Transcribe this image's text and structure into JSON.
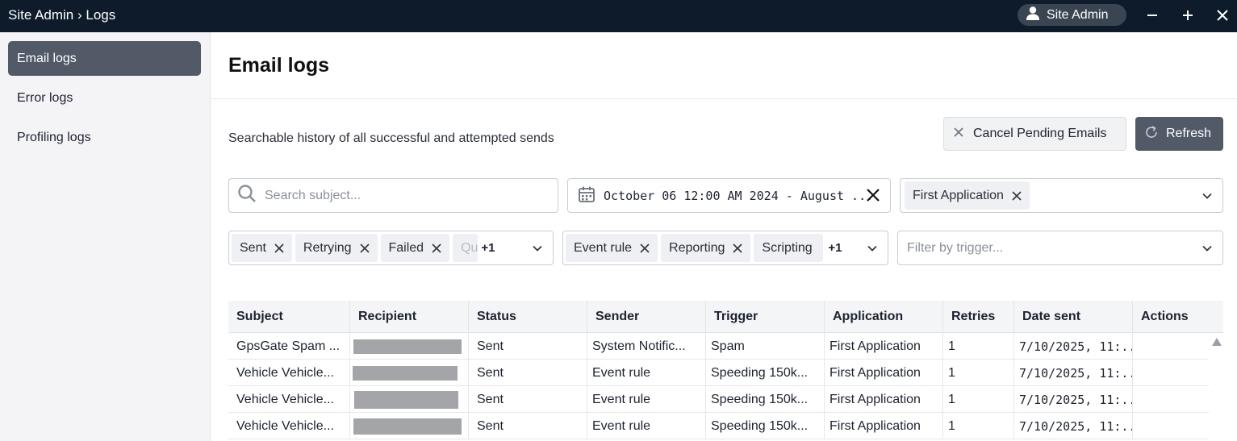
{
  "titlebar": {
    "breadcrumb": "Site Admin › Logs",
    "user_label": "Site Admin",
    "icons": [
      "user-icon",
      "minimize-icon",
      "maximize-icon",
      "close-icon"
    ]
  },
  "sidebar": {
    "items": [
      {
        "label": "Email logs",
        "active": true
      },
      {
        "label": "Error logs",
        "active": false
      },
      {
        "label": "Profiling logs",
        "active": false
      }
    ]
  },
  "main": {
    "title": "Email logs",
    "subtitle": "Searchable history of all successful and attempted sends",
    "cancel_label": "Cancel Pending Emails",
    "refresh_label": "Refresh"
  },
  "filters": {
    "search_placeholder": "Search subject...",
    "date_range": "October 06 12:00 AM 2024 - August ...",
    "application_chip": "First Application",
    "status_chips": [
      "Sent",
      "Retrying",
      "Failed"
    ],
    "status_partial": "Qu",
    "status_more": "+1",
    "trigger_chips": [
      "Event rule",
      "Reporting"
    ],
    "trigger_partial": "Scripting",
    "trigger_more": "+1",
    "trigger_placeholder": "Filter by trigger..."
  },
  "table": {
    "headers": [
      "Subject",
      "Recipient",
      "Status",
      "Sender",
      "Trigger",
      "Application",
      "Retries",
      "Date sent",
      "Actions"
    ],
    "rows": [
      {
        "subject": "GpsGate Spam ...",
        "status": "Sent",
        "sender": "System Notific...",
        "trigger": "Spam",
        "application": "First Application",
        "retries": "1",
        "date": "7/10/2025, 11:..."
      },
      {
        "subject": "Vehicle Vehicle...",
        "status": "Sent",
        "sender": "Event rule",
        "trigger": "Speeding 150k...",
        "application": "First Application",
        "retries": "1",
        "date": "7/10/2025, 11:..."
      },
      {
        "subject": "Vehicle Vehicle...",
        "status": "Sent",
        "sender": "Event rule",
        "trigger": "Speeding 150k...",
        "application": "First Application",
        "retries": "1",
        "date": "7/10/2025, 11:..."
      },
      {
        "subject": "Vehicle Vehicle...",
        "status": "Sent",
        "sender": "Event rule",
        "trigger": "Speeding 150k...",
        "application": "First Application",
        "retries": "1",
        "date": "7/10/2025, 11:..."
      }
    ]
  },
  "colors": {
    "titlebar_bg": "#0d1b2a",
    "active_nav_bg": "#525a68",
    "refresh_bg": "#525a68",
    "redaction": "#a3a5a9"
  }
}
